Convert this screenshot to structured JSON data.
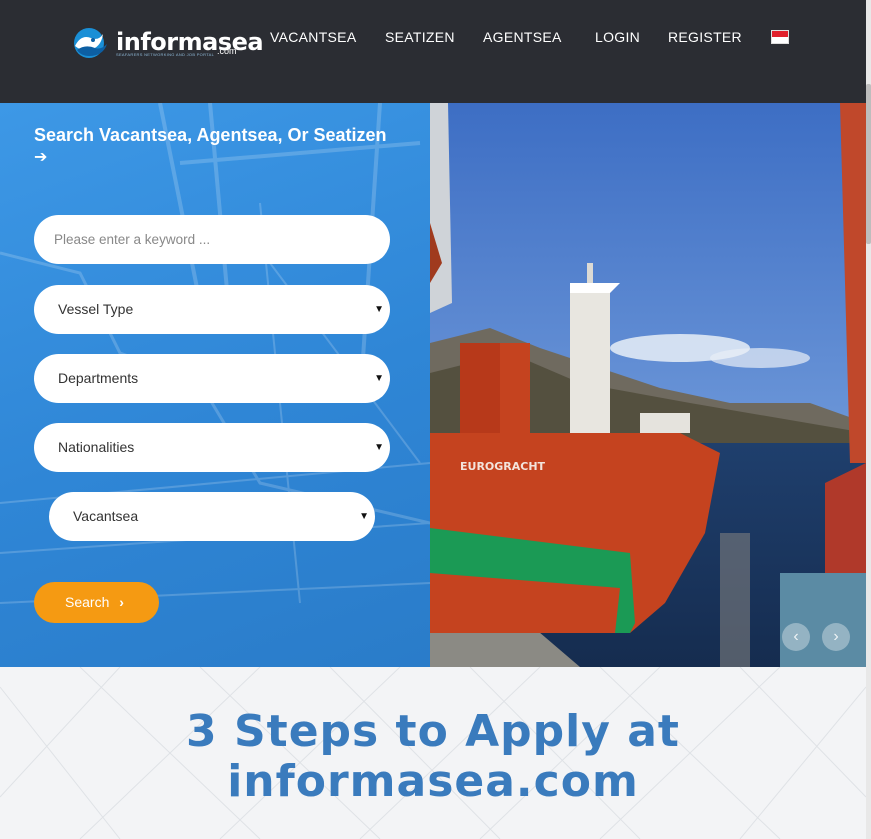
{
  "header": {
    "logo_text": "informasea",
    "logo_suffix": ".com",
    "logo_tagline": "SEAFARERS NETWORKING AND JOB PORTAL",
    "nav": [
      "VACANTSEA",
      "SEATIZEN",
      "AGENTSEA",
      "LOGIN",
      "REGISTER"
    ],
    "flag_icon": "indonesia-flag-icon"
  },
  "hero": {
    "search_title": "Search Vacantsea, Agentsea, Or Seatizen",
    "arrow_icon": "arrow-right-icon",
    "keyword_placeholder": "Please enter a keyword ...",
    "selects": {
      "vessel_type": "Vessel Type",
      "departments": "Departments",
      "nationalities": "Nationalities",
      "category": "Vacantsea"
    },
    "search_button": "Search",
    "ship_name": "EUROGRACHT"
  },
  "steps": {
    "title_line1": "3 Steps to Apply at",
    "title_line2": "informasea.com"
  },
  "colors": {
    "header_bg": "#2b2d33",
    "hero_blue": "#3d98e6",
    "search_button": "#f59a12",
    "steps_title": "#3a7bbd"
  }
}
